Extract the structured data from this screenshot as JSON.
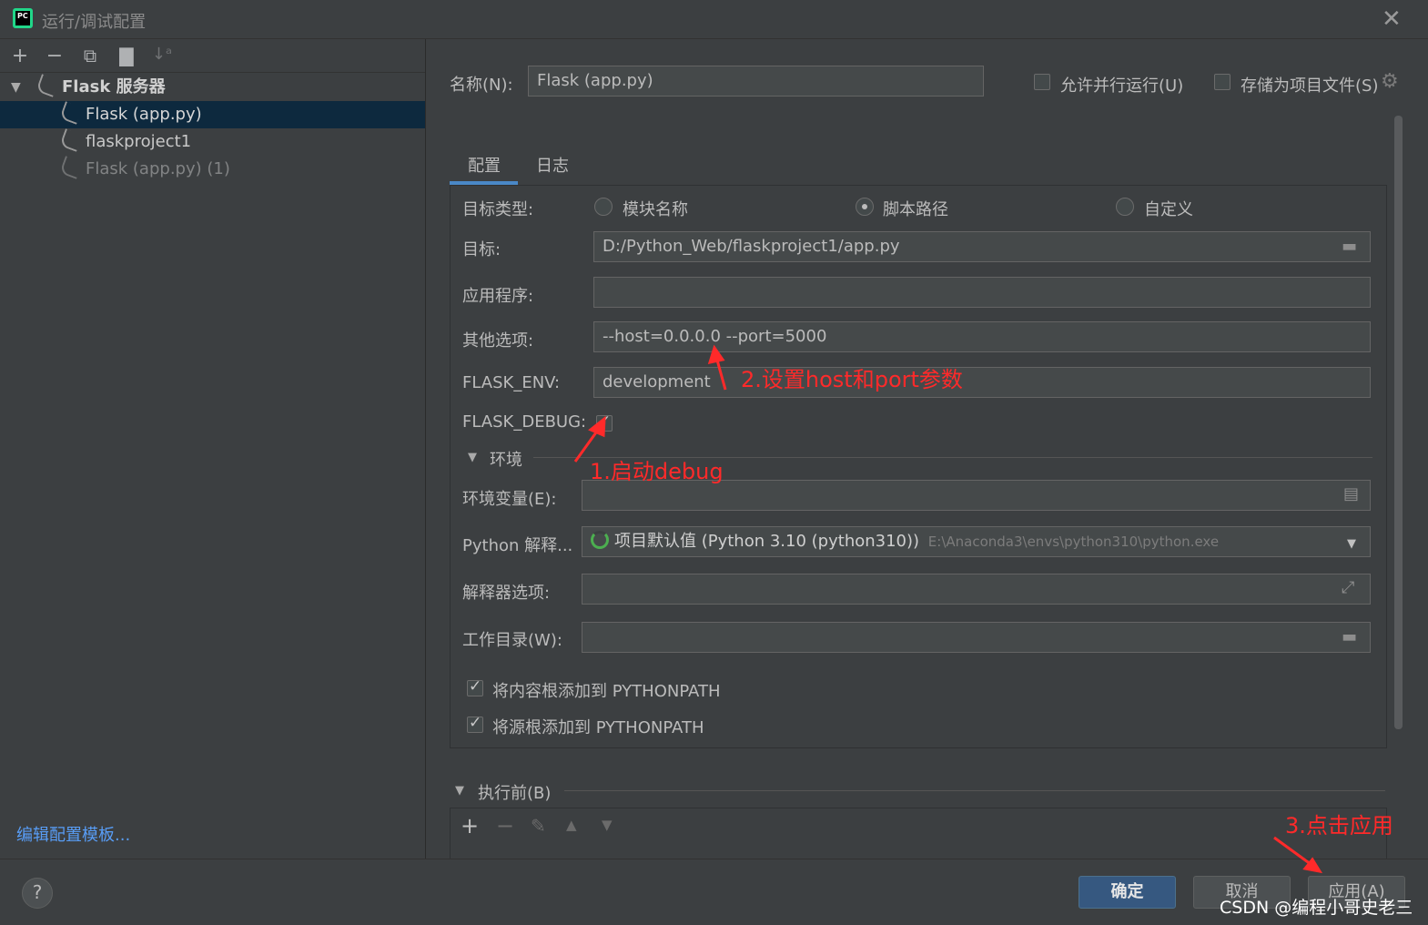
{
  "window": {
    "title": "运行/调试配置",
    "app_icon_text": "PC"
  },
  "left_toolbar": {
    "icons": [
      "add-icon",
      "remove-icon",
      "copy-icon",
      "new-folder-icon",
      "sort-icon"
    ]
  },
  "tree": {
    "group": "Flask 服务器",
    "items": [
      {
        "label": "Flask (app.py)",
        "selected": true
      },
      {
        "label": "flaskproject1"
      },
      {
        "label": "Flask (app.py) (1)",
        "dimmed": true
      }
    ]
  },
  "edit_templates_link": "编辑配置模板...",
  "header": {
    "name_label": "名称(N):",
    "name_value": "Flask (app.py)",
    "allow_parallel": "允许并行运行(U)",
    "store_as_project": "存储为项目文件(S)"
  },
  "tabs": [
    {
      "label": "配置",
      "active": true
    },
    {
      "label": "日志"
    }
  ],
  "config": {
    "target_type_label": "目标类型:",
    "target_type_options": [
      "模块名称",
      "脚本路径",
      "自定义"
    ],
    "target_type_selected": "脚本路径",
    "target_label": "目标:",
    "target_value": "D:/Python_Web/flaskproject1/app.py",
    "app_label": "应用程序:",
    "app_value": "",
    "options_label": "其他选项:",
    "options_value": "--host=0.0.0.0 --port=5000",
    "flask_env_label": "FLASK_ENV:",
    "flask_env_value": "development",
    "flask_debug_label": "FLASK_DEBUG:",
    "flask_debug_checked": true,
    "env_section": "环境",
    "env_vars_label": "环境变量(E):",
    "interpreter_label": "Python 解释...",
    "interpreter_value": "项目默认值 (Python 3.10 (python310))",
    "interpreter_path": "E:\\Anaconda3\\envs\\python310\\python.exe",
    "interp_options_label": "解释器选项:",
    "workdir_label": "工作目录(W):",
    "add_content_roots": "将内容根添加到 PYTHONPATH",
    "add_source_roots": "将源根添加到 PYTHONPATH"
  },
  "before_launch": {
    "label": "执行前(B)"
  },
  "annotations": {
    "a1": "1.启动debug",
    "a2": "2.设置host和port参数",
    "a3": "3.点击应用"
  },
  "buttons": {
    "ok": "确定",
    "cancel": "取消",
    "apply": "应用(A)",
    "help": "?"
  },
  "watermark": "CSDN @编程小哥史老三",
  "colors": {
    "accent": "#4a88c7",
    "selection": "#0d293e",
    "annotation": "#ff2a2a",
    "link": "#589df6",
    "primary_button": "#365880"
  }
}
